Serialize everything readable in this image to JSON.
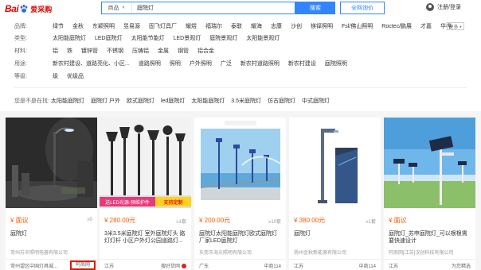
{
  "header": {
    "logo_text": "Bai",
    "logo_cn": "爱采购",
    "search_category": "商品",
    "search_value": "庭院灯",
    "search_button": "搜索",
    "ask_button": "全网询价",
    "login": "注册/登录"
  },
  "filters": {
    "rows": [
      {
        "label": "品牌:",
        "items": [
          "绿节",
          "金秋",
          "东颖照明",
          "昱易源",
          "固飞灯具厂",
          "耀煜",
          "福瑞尔",
          "泰联",
          "耀海",
          "志康",
          "沙创",
          "镁铎照明",
          "Fsl/佛山照明",
          "Roctec/鹏展",
          "才嘉",
          "华桦"
        ]
      },
      {
        "label": "类型:",
        "items": [
          "太阳能庭院灯",
          "LED庭院灯",
          "太阳能节能灯",
          "LED景观灯",
          "庭院景观灯",
          "太阳能景观灯"
        ]
      },
      {
        "label": "材料:",
        "items": [
          "铝",
          "铁",
          "镀锌管",
          "不锈钢",
          "压铸铝",
          "金属",
          "钢管",
          "铝合金"
        ]
      },
      {
        "label": "用途:",
        "items": [
          "新农村建设、道路亮化、小区...",
          "道路照明",
          "照明",
          "户外照明",
          "广泛",
          "新农村道路照明",
          "新农村建设",
          "庭院照明"
        ]
      },
      {
        "label": "等级:",
        "items": [
          "级",
          "优级品"
        ]
      }
    ],
    "more_label": "更多",
    "related_label": "您是不是在找:",
    "related": [
      "太阳能庭院灯",
      "庭院灯 户外",
      "欧式庭院灯",
      "led庭院灯",
      "太阳能庭院灯",
      "3.5米庭院灯",
      "仿古庭院灯",
      "中式庭院灯"
    ]
  },
  "cards": [
    {
      "price": "¥ 面议",
      "count": "≥0",
      "title": "庭院灯",
      "seller": "常州苏辛照明电器有限公司",
      "location": "常州望区中国灯具城...",
      "source": "阿商网"
    },
    {
      "price": "¥ 280.00元",
      "count": "≥1套",
      "title": "3米3.5米庭院灯 室外庭院灯头 路灯灯杆 小区户外灯公园道路灯...",
      "seller": "",
      "location": "江苏",
      "source": "搜好货网",
      "img_banner_left": "送LED光源-预维护件",
      "img_banner_right": "支持定制"
    },
    {
      "price": "¥ 200.00元",
      "count": "≥10套",
      "title": "庭院灯太阳能庭院灯欧式庭院灯厂家LED庭院灯",
      "seller": "东莞市海光照明有限公司",
      "location": "广东",
      "source": "中商114"
    },
    {
      "price": "¥ 380.00元",
      "count": "≥1套",
      "title": "庭院灯",
      "seller": "扬州金秋新能源有限公司",
      "location": "江苏",
      "source": "中商114"
    },
    {
      "price": "¥ 面议",
      "count": "",
      "title": "庭院灯_苏申庭院灯_可以根根需要快速设计",
      "seller": "阿商网[江苏]汉创科技有限公司",
      "location": "江苏",
      "source": "为您精选"
    }
  ],
  "colors": {
    "accent": "#3385ff",
    "price": "#ff5500",
    "brand": "#e10601",
    "highlight_box": "#d81e06"
  }
}
